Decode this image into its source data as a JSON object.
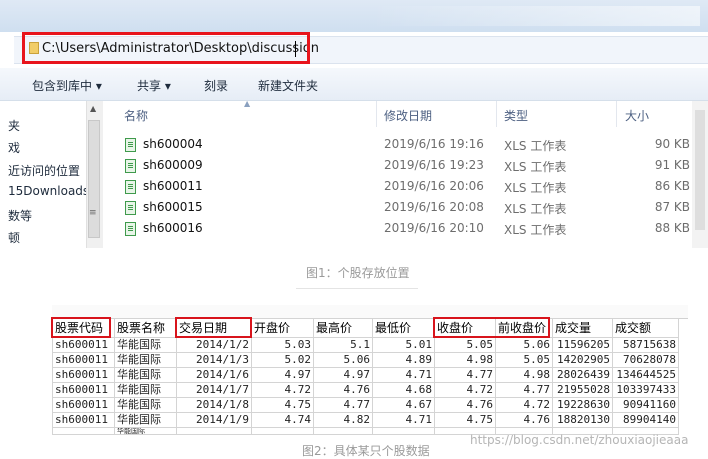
{
  "address": {
    "path": "C:\\Users\\Administrator\\Desktop\\discussion"
  },
  "toolbar": {
    "include_library": "包含到库中 ▾",
    "share": "共享 ▾",
    "burn": "刻录",
    "new_folder": "新建文件夹"
  },
  "nav": [
    "夹",
    "戏",
    "近访问的位置",
    "15Downloads",
    "数等",
    "顿"
  ],
  "columns": {
    "name": "名称",
    "modified": "修改日期",
    "type": "类型",
    "size": "大小"
  },
  "files": [
    {
      "name": "sh600004",
      "date": "2019/6/16 19:16",
      "type": "XLS 工作表",
      "size": "90 KB"
    },
    {
      "name": "sh600009",
      "date": "2019/6/16 19:23",
      "type": "XLS 工作表",
      "size": "91 KB"
    },
    {
      "name": "sh600011",
      "date": "2019/6/16 20:06",
      "type": "XLS 工作表",
      "size": "86 KB"
    },
    {
      "name": "sh600015",
      "date": "2019/6/16 20:08",
      "type": "XLS 工作表",
      "size": "87 KB"
    },
    {
      "name": "sh600016",
      "date": "2019/6/16 20:10",
      "type": "XLS 工作表",
      "size": "88 KB"
    }
  ],
  "caption1": "图1：个股存放位置",
  "caption2": "图2：具体某只个股数据",
  "sheet": {
    "headers": [
      "股票代码",
      "股票名称",
      "交易日期",
      "开盘价",
      "最高价",
      "最低价",
      "收盘价",
      "前收盘价",
      "成交量",
      "成交额"
    ],
    "rows": [
      [
        "sh600011",
        "华能国际",
        "2014/1/2",
        "5.03",
        "5.1",
        "5.01",
        "5.05",
        "5.06",
        "11596205",
        "58715638"
      ],
      [
        "sh600011",
        "华能国际",
        "2014/1/3",
        "5.02",
        "5.06",
        "4.89",
        "4.98",
        "5.05",
        "14202905",
        "70628078"
      ],
      [
        "sh600011",
        "华能国际",
        "2014/1/6",
        "4.97",
        "4.97",
        "4.71",
        "4.77",
        "4.98",
        "28026439",
        "134644525"
      ],
      [
        "sh600011",
        "华能国际",
        "2014/1/7",
        "4.72",
        "4.76",
        "4.68",
        "4.72",
        "4.77",
        "21955028",
        "103397433"
      ],
      [
        "sh600011",
        "华能国际",
        "2014/1/8",
        "4.75",
        "4.77",
        "4.67",
        "4.76",
        "4.72",
        "19228630",
        "90941160"
      ],
      [
        "sh600011",
        "华能国际",
        "2014/1/9",
        "4.74",
        "4.82",
        "4.71",
        "4.75",
        "4.76",
        "18820130",
        "89904140"
      ]
    ],
    "partial_row_name": "华能国际"
  },
  "watermark": "https://blog.csdn.net/zhouxiaojieaaa",
  "colors": {
    "highlight": "#e8141c",
    "header_text": "#4d6082"
  }
}
